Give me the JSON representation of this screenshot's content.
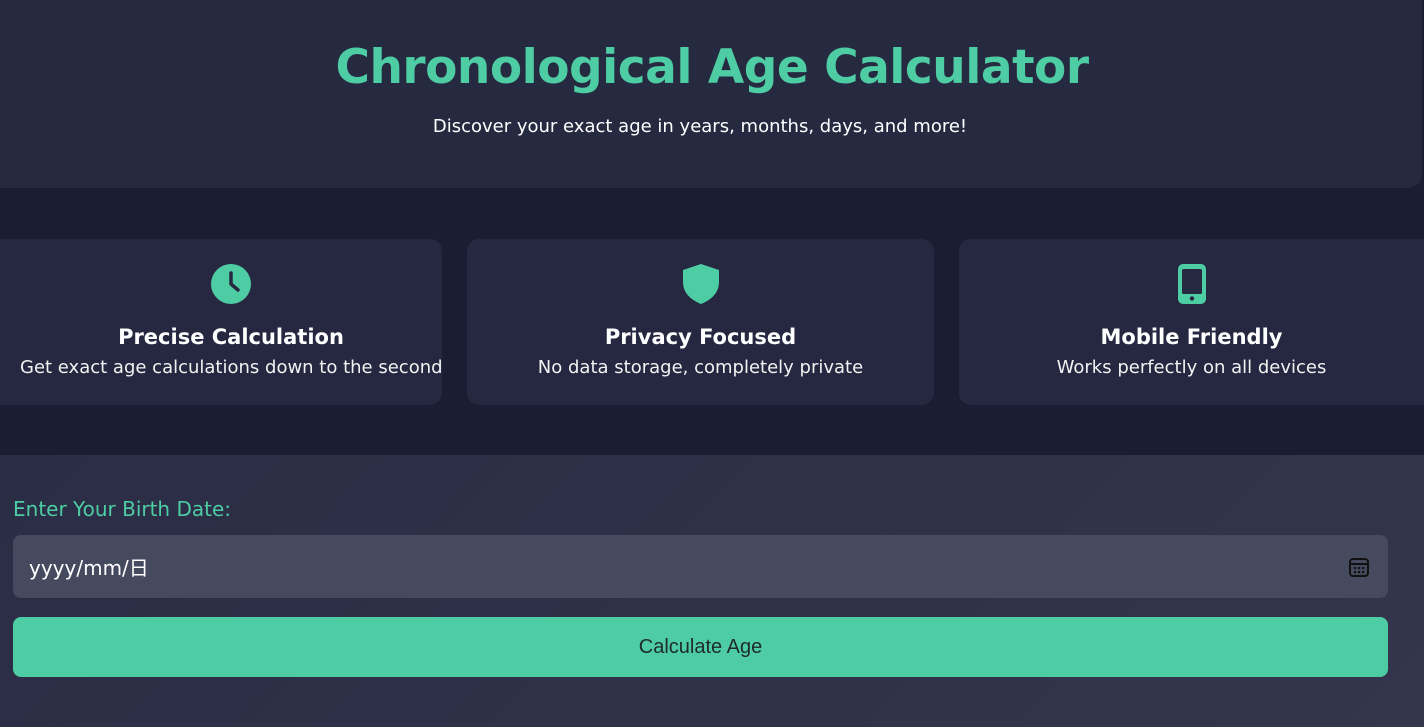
{
  "header": {
    "title": "Chronological Age Calculator",
    "subtitle": "Discover your exact age in years, months, days, and more!"
  },
  "features": [
    {
      "icon": "clock-icon",
      "title": "Precise Calculation",
      "text": "Get exact age calculations down to the second"
    },
    {
      "icon": "shield-icon",
      "title": "Privacy Focused",
      "text": "No data storage, completely private"
    },
    {
      "icon": "smartphone-icon",
      "title": "Mobile Friendly",
      "text": "Works perfectly on all devices"
    }
  ],
  "form": {
    "label": "Enter Your Birth Date:",
    "date_placeholder": "yyyy/mm/日",
    "button_label": "Calculate Age"
  },
  "colors": {
    "accent": "#4ecca3",
    "background": "#1b1d33",
    "card": "#252840",
    "input": "#464a5f"
  }
}
